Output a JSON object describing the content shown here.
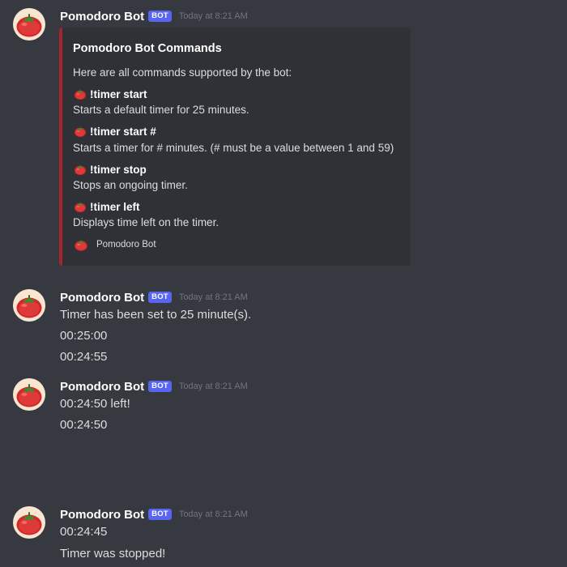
{
  "colors": {
    "background": "#36393f",
    "embed_background": "#2f3136",
    "embed_accent": "#a5252c",
    "bot_tag": "#5865f2",
    "username": "#ffffff",
    "timestamp": "#72767d",
    "text": "#dcddde"
  },
  "icons": {
    "avatar": "tomato-icon",
    "field": "tomato-icon",
    "footer": "tomato-icon"
  },
  "messages": [
    {
      "author": "Pomodoro Bot",
      "tag": "BOT",
      "timestamp": "Today at 8:21 AM",
      "embed": {
        "title": "Pomodoro Bot Commands",
        "description": "Here are all commands supported by the bot:",
        "fields": [
          {
            "name": "!timer start",
            "value": "Starts a default timer for 25 minutes."
          },
          {
            "name": "!timer start #",
            "value": "Starts a timer for # minutes. (# must be a value between 1 and 59)"
          },
          {
            "name": "!timer stop",
            "value": "Stops an ongoing timer."
          },
          {
            "name": "!timer left",
            "value": "Displays time left on the timer."
          }
        ],
        "footer": "Pomodoro Bot"
      }
    },
    {
      "author": "Pomodoro Bot",
      "tag": "BOT",
      "timestamp": "Today at 8:21 AM",
      "lines": [
        "Timer has been set to 25 minute(s).",
        "00:25:00",
        "00:24:55"
      ]
    },
    {
      "author": "Pomodoro Bot",
      "tag": "BOT",
      "timestamp": "Today at 8:21 AM",
      "lines": [
        "00:24:50 left!",
        "00:24:50"
      ]
    },
    {
      "author": "Pomodoro Bot",
      "tag": "BOT",
      "timestamp": "Today at 8:21 AM",
      "lines": [
        "00:24:45",
        "Timer was stopped!"
      ]
    }
  ]
}
